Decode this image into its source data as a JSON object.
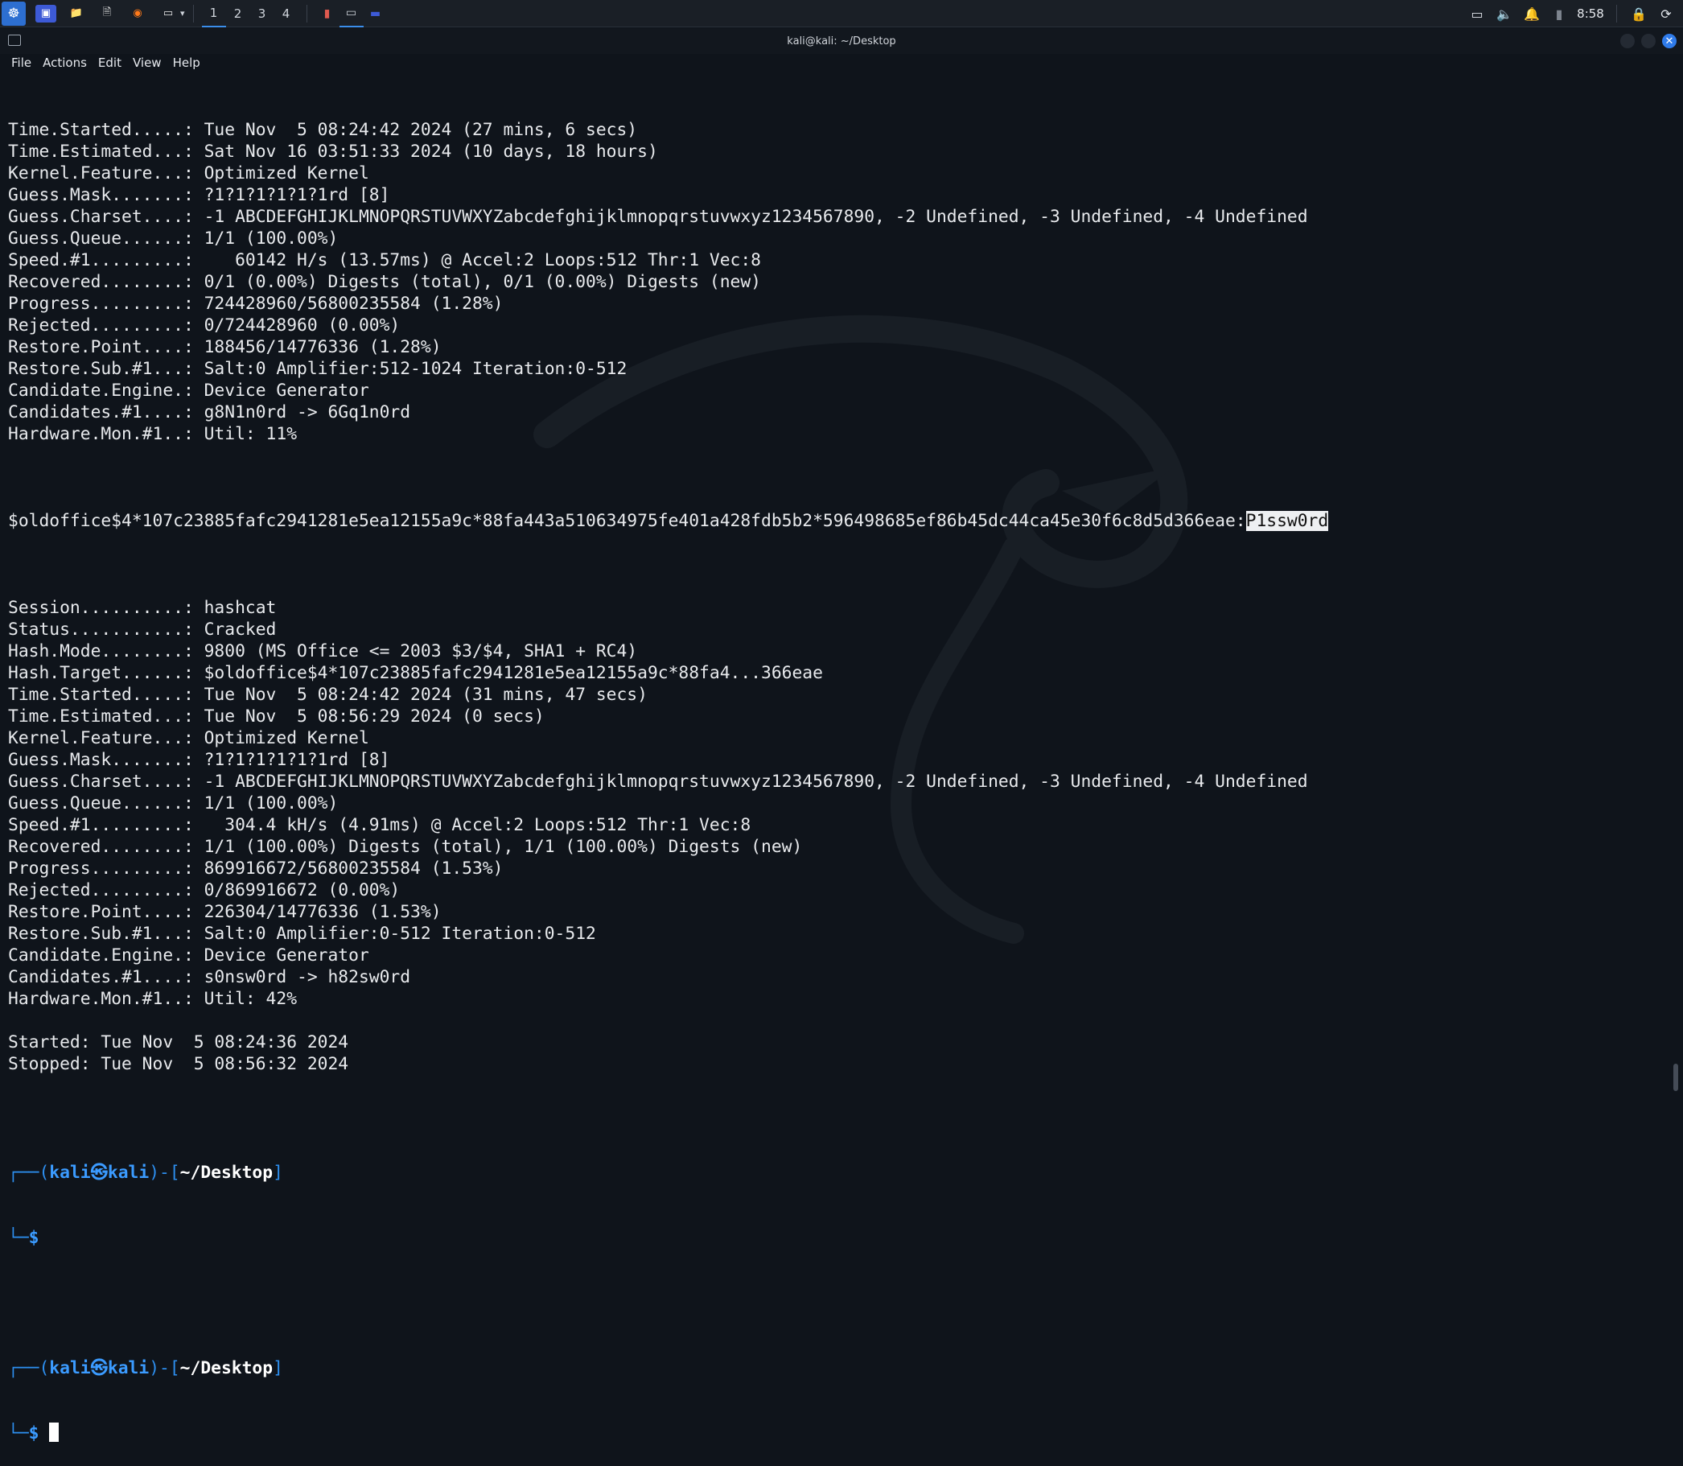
{
  "panel": {
    "workspaces": [
      "1",
      "2",
      "3",
      "4"
    ],
    "active_workspace": "1",
    "clock": "8:58"
  },
  "window": {
    "title": "kali@kali: ~/Desktop",
    "menu": [
      "File",
      "Actions",
      "Edit",
      "View",
      "Help"
    ]
  },
  "terminal": {
    "lines": [
      "Time.Started.....: Tue Nov  5 08:24:42 2024 (27 mins, 6 secs)",
      "Time.Estimated...: Sat Nov 16 03:51:33 2024 (10 days, 18 hours)",
      "Kernel.Feature...: Optimized Kernel",
      "Guess.Mask.......: ?1?1?1?1?1?1rd [8]",
      "Guess.Charset....: -1 ABCDEFGHIJKLMNOPQRSTUVWXYZabcdefghijklmnopqrstuvwxyz1234567890, -2 Undefined, -3 Undefined, -4 Undefined",
      "Guess.Queue......: 1/1 (100.00%)",
      "Speed.#1.........:    60142 H/s (13.57ms) @ Accel:2 Loops:512 Thr:1 Vec:8",
      "Recovered........: 0/1 (0.00%) Digests (total), 0/1 (0.00%) Digests (new)",
      "Progress.........: 724428960/56800235584 (1.28%)",
      "Rejected.........: 0/724428960 (0.00%)",
      "Restore.Point....: 188456/14776336 (1.28%)",
      "Restore.Sub.#1...: Salt:0 Amplifier:512-1024 Iteration:0-512",
      "Candidate.Engine.: Device Generator",
      "Candidates.#1....: g8N1n0rd -> 6Gq1n0rd",
      "Hardware.Mon.#1..: Util: 11%",
      ""
    ],
    "hash_line": "$oldoffice$4*107c23885fafc2941281e5ea12155a9c*88fa443a510634975fe401a428fdb5b2*596498685ef86b45dc44ca45e30f6c8d5d366eae:",
    "cracked_password": "P1ssw0rd",
    "lines2": [
      "",
      "Session..........: hashcat",
      "Status...........: Cracked",
      "Hash.Mode........: 9800 (MS Office <= 2003 $3/$4, SHA1 + RC4)",
      "Hash.Target......: $oldoffice$4*107c23885fafc2941281e5ea12155a9c*88fa4...366eae",
      "Time.Started.....: Tue Nov  5 08:24:42 2024 (31 mins, 47 secs)",
      "Time.Estimated...: Tue Nov  5 08:56:29 2024 (0 secs)",
      "Kernel.Feature...: Optimized Kernel",
      "Guess.Mask.......: ?1?1?1?1?1?1rd [8]",
      "Guess.Charset....: -1 ABCDEFGHIJKLMNOPQRSTUVWXYZabcdefghijklmnopqrstuvwxyz1234567890, -2 Undefined, -3 Undefined, -4 Undefined",
      "Guess.Queue......: 1/1 (100.00%)",
      "Speed.#1.........:   304.4 kH/s (4.91ms) @ Accel:2 Loops:512 Thr:1 Vec:8",
      "Recovered........: 1/1 (100.00%) Digests (total), 1/1 (100.00%) Digests (new)",
      "Progress.........: 869916672/56800235584 (1.53%)",
      "Rejected.........: 0/869916672 (0.00%)",
      "Restore.Point....: 226304/14776336 (1.53%)",
      "Restore.Sub.#1...: Salt:0 Amplifier:0-512 Iteration:0-512",
      "Candidate.Engine.: Device Generator",
      "Candidates.#1....: s0nsw0rd -> h82sw0rd",
      "Hardware.Mon.#1..: Util: 42%",
      "",
      "Started: Tue Nov  5 08:24:36 2024",
      "Stopped: Tue Nov  5 08:56:32 2024",
      ""
    ],
    "prompt": {
      "user": "kali",
      "host": "kali",
      "dir": "~/Desktop",
      "symbol": "$"
    }
  }
}
